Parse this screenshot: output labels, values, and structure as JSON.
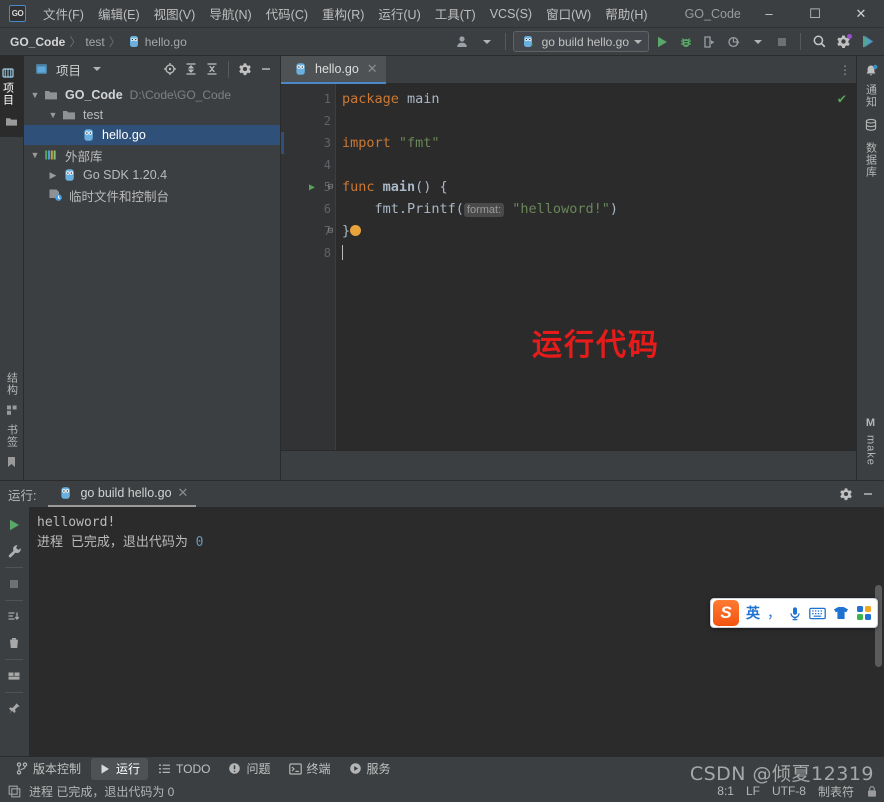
{
  "window": {
    "title": "GO_Code",
    "minimize": "–",
    "maximize": "☐",
    "close": "✕",
    "logo": "GO"
  },
  "menu": {
    "items": [
      {
        "label": "文件(F)",
        "name": "menu-file"
      },
      {
        "label": "编辑(E)",
        "name": "menu-edit"
      },
      {
        "label": "视图(V)",
        "name": "menu-view"
      },
      {
        "label": "导航(N)",
        "name": "menu-navigate"
      },
      {
        "label": "代码(C)",
        "name": "menu-code"
      },
      {
        "label": "重构(R)",
        "name": "menu-refactor"
      },
      {
        "label": "运行(U)",
        "name": "menu-run"
      },
      {
        "label": "工具(T)",
        "name": "menu-tools"
      },
      {
        "label": "VCS(S)",
        "name": "menu-vcs"
      },
      {
        "label": "窗口(W)",
        "name": "menu-window"
      },
      {
        "label": "帮助(H)",
        "name": "menu-help"
      }
    ]
  },
  "toolbar": {
    "breadcrumb": [
      "GO_Code",
      "test",
      "hello.go"
    ],
    "separator": "〉",
    "run_config": "go build hello.go",
    "icons": {
      "account": "account-icon",
      "run": "run-icon",
      "debug": "debug-icon",
      "coverage": "run-with-coverage-icon",
      "profile": "profiler-icon",
      "stop": "stop-icon",
      "search": "search-icon",
      "settings": "settings-icon",
      "updates": "updates-icon"
    }
  },
  "left_rail": {
    "top_tabs": [
      {
        "label": "项目",
        "name": "rail-tab-project",
        "icon": "project-icon"
      }
    ],
    "commit_icon": "commit-icon",
    "bottom_tabs": [
      {
        "label": "结构",
        "name": "rail-tab-structure",
        "icon": "structure-icon"
      },
      {
        "label": "书签",
        "name": "rail-tab-bookmarks",
        "icon": "bookmark-icon"
      }
    ]
  },
  "project_panel": {
    "title": "项目",
    "tools": [
      "locate-icon",
      "expand-all-icon",
      "collapse-all-icon",
      "settings-icon",
      "hide-icon"
    ],
    "tree": [
      {
        "label": "GO_Code",
        "path": "D:\\Code\\GO_Code",
        "depth": 0,
        "expanded": true,
        "icon": "folder-icon",
        "selected": false,
        "bold": true
      },
      {
        "label": "test",
        "path": "",
        "depth": 1,
        "expanded": true,
        "icon": "folder-icon",
        "selected": false,
        "bold": false
      },
      {
        "label": "hello.go",
        "path": "",
        "depth": 2,
        "expanded": null,
        "icon": "go-file-icon",
        "selected": true,
        "bold": false
      },
      {
        "label": "外部库",
        "path": "",
        "depth": 0,
        "expanded": true,
        "icon": "library-icon",
        "selected": false,
        "bold": false
      },
      {
        "label": "Go SDK 1.20.4",
        "path": "",
        "depth": 1,
        "expanded": false,
        "icon": "go-file-icon",
        "selected": false,
        "bold": false
      },
      {
        "label": "临时文件和控制台",
        "path": "",
        "depth": 0,
        "expanded": null,
        "icon": "scratch-icon",
        "selected": false,
        "bold": false
      }
    ]
  },
  "editor": {
    "tab": {
      "label": "hello.go",
      "close": "✕",
      "icon": "go-file-icon"
    },
    "more_icon": "more-options-icon",
    "inspection_ok": "✔",
    "line_numbers": [
      "1",
      "2",
      "3",
      "4",
      "5",
      "6",
      "7",
      "8"
    ],
    "code": {
      "l1_kw": "package",
      "l1_name": "main",
      "l3_kw": "import",
      "l3_str": "\"fmt\"",
      "l5_kw": "func",
      "l5_name": "main",
      "l5_rest": "() {",
      "l6_call": "fmt.Printf(",
      "l6_hint": "format:",
      "l6_str": "\"helloword!\"",
      "l6_close": ")",
      "l7": "}"
    },
    "annotation": "运行代码",
    "annotation_color": "#e81b1b"
  },
  "right_rail": {
    "tabs": [
      {
        "label": "通知",
        "name": "rail-tab-notifications",
        "icon": "bell-icon"
      },
      {
        "label": "数据库",
        "name": "rail-tab-database",
        "icon": "database-icon"
      }
    ],
    "bottom": {
      "label": "make",
      "prefix": "M",
      "name": "rail-tab-make"
    }
  },
  "run_panel": {
    "label": "运行:",
    "tab": {
      "label": "go build hello.go",
      "close": "✕",
      "icon": "go-file-icon"
    },
    "head_icons": [
      "settings-icon",
      "hide-icon"
    ],
    "side_icons": [
      {
        "name": "rerun-icon"
      },
      {
        "name": "wrench-icon"
      },
      {
        "name": "stop-icon"
      },
      {
        "name": "scroll-to-end-icon"
      },
      {
        "name": "trash-icon"
      },
      {
        "name": "layout-icon"
      },
      {
        "name": "pin-icon"
      }
    ],
    "console": {
      "line1": "helloword!",
      "line2_text": "进程 已完成，退出代码为 ",
      "line2_code": "0"
    }
  },
  "tool_window_bar": {
    "tabs": [
      {
        "label": "版本控制",
        "name": "toolwin-tab-vcs",
        "icon": "branch-icon",
        "active": false
      },
      {
        "label": "运行",
        "name": "toolwin-tab-run",
        "icon": "run-icon",
        "active": true
      },
      {
        "label": "TODO",
        "name": "toolwin-tab-todo",
        "icon": "todo-icon",
        "active": false
      },
      {
        "label": "问题",
        "name": "toolwin-tab-problems",
        "icon": "problems-icon",
        "active": false
      },
      {
        "label": "终端",
        "name": "toolwin-tab-terminal",
        "icon": "terminal-icon",
        "active": false
      },
      {
        "label": "服务",
        "name": "toolwin-tab-services",
        "icon": "services-icon",
        "active": false
      }
    ]
  },
  "status_bar": {
    "message": "进程 已完成，退出代码为 0",
    "caret": "8:1",
    "line_sep": "LF",
    "encoding": "UTF-8",
    "indent": "制表符",
    "lock_icon": "lock-icon",
    "copy_icon": "copy-icon"
  },
  "ime": {
    "logo": "S",
    "mode": "英",
    "punct": "，",
    "icons": [
      "mic-icon",
      "keyboard-icon",
      "skin-icon",
      "apps-icon"
    ]
  },
  "watermark": "CSDN @倾夏12319"
}
